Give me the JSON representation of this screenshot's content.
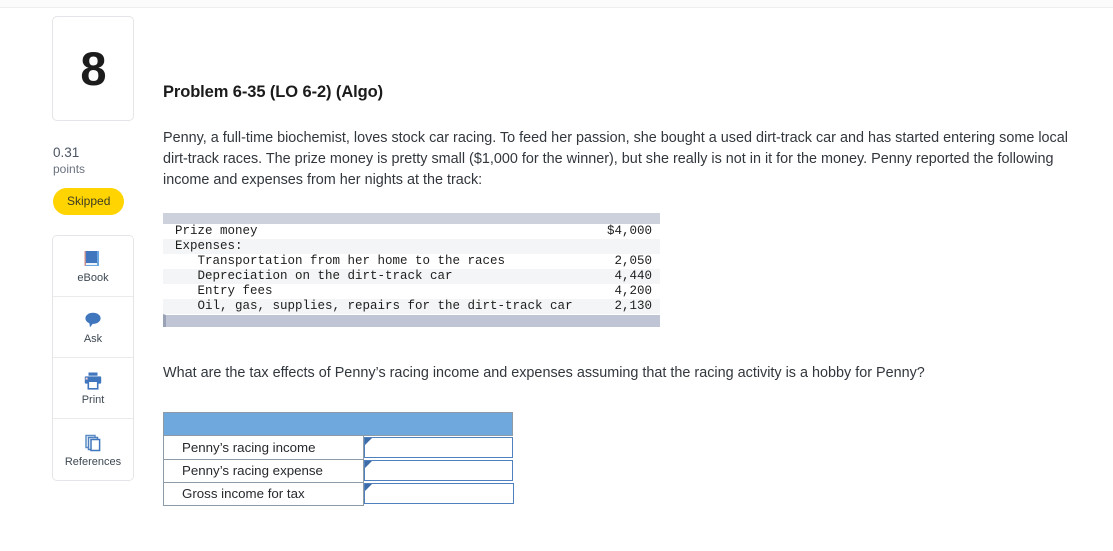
{
  "question": {
    "number": "8",
    "points_value": "0.31",
    "points_label": "points",
    "status_badge": "Skipped",
    "title": "Problem 6-35 (LO 6-2) (Algo)",
    "body": "Penny, a full-time biochemist, loves stock car racing. To feed her passion, she bought a used dirt-track car and has started entering some local dirt-track races. The prize money is pretty small ($1,000 for the winner), but she really is not in it for the money. Penny reported the following income and expenses from her nights at the track:",
    "prompt": "What are the tax effects of Penny’s racing income and expenses assuming that the racing activity is a hobby for Penny?"
  },
  "tools": [
    {
      "label": "eBook",
      "icon": "ebook-icon"
    },
    {
      "label": "Ask",
      "icon": "chat-bubble-icon"
    },
    {
      "label": "Print",
      "icon": "printer-icon"
    },
    {
      "label": "References",
      "icon": "copy-pages-icon"
    }
  ],
  "financial_table": {
    "rows": [
      {
        "label": "Prize money",
        "value": "$4,000",
        "indent": 0
      },
      {
        "label": "Expenses:",
        "value": "",
        "indent": 0
      },
      {
        "label": "Transportation from her home to the races",
        "value": "2,050",
        "indent": 1
      },
      {
        "label": "Depreciation on the dirt-track car",
        "value": "4,440",
        "indent": 1
      },
      {
        "label": "Entry fees",
        "value": "4,200",
        "indent": 1
      },
      {
        "label": "Oil, gas, supplies, repairs for the dirt-track car",
        "value": "2,130",
        "indent": 1
      }
    ]
  },
  "answer_table": {
    "header_label": "",
    "rows": [
      {
        "label": "Penny’s racing income",
        "value": "",
        "placeholder": ""
      },
      {
        "label": "Penny’s racing expense",
        "value": "",
        "placeholder": ""
      },
      {
        "label": "Gross income for tax",
        "value": "",
        "placeholder": ""
      }
    ]
  },
  "colors": {
    "badge_yellow": "#ffd400",
    "table_header_blue": "#6fa8dc",
    "input_border_blue": "#4e81bd",
    "fin_topbar": "#ccd1dc",
    "fin_botbar": "#bfc5d4",
    "icon_blue": "#3f76bd"
  }
}
